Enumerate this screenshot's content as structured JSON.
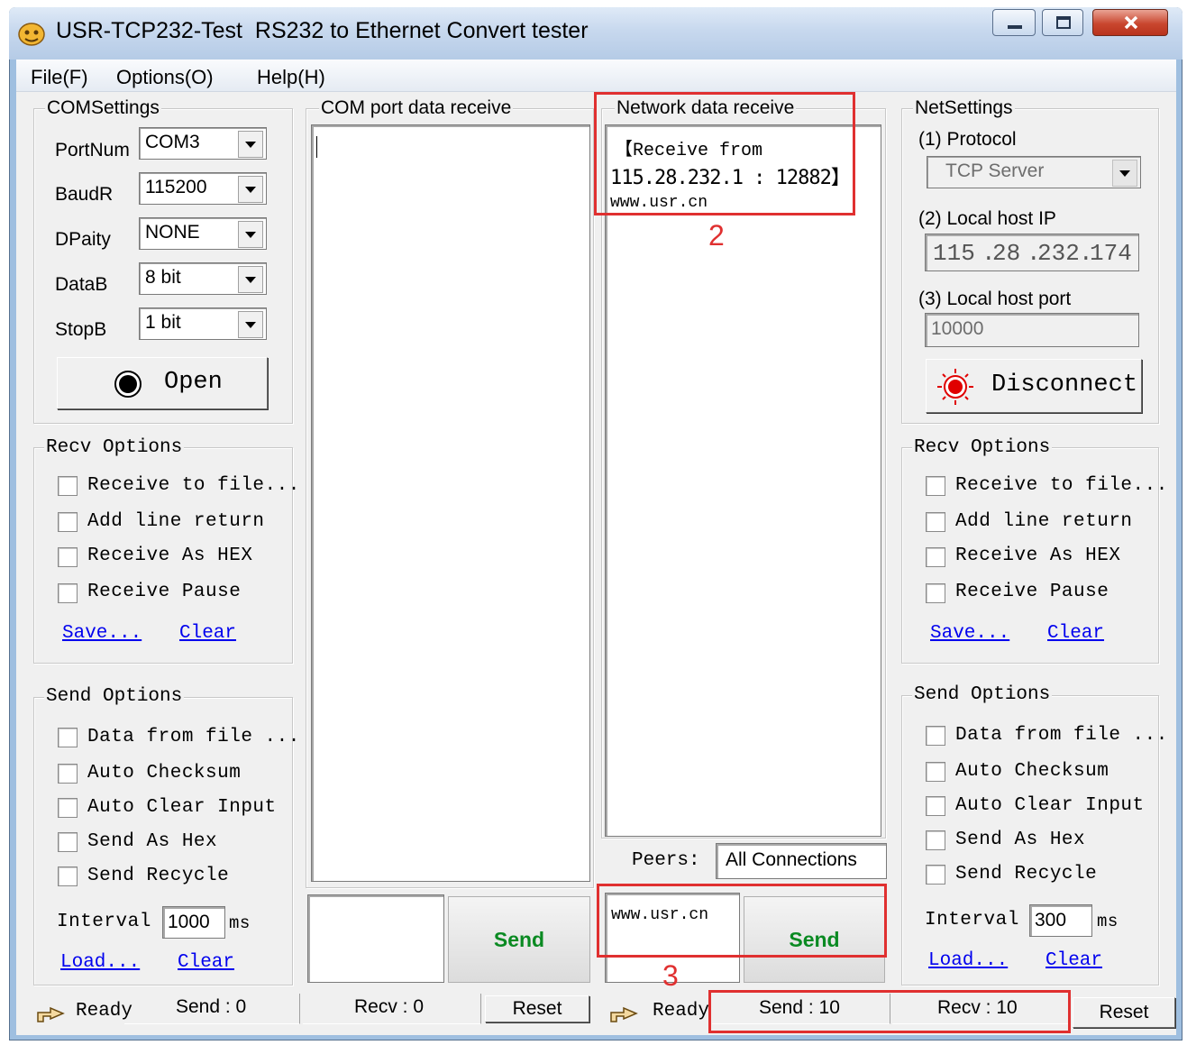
{
  "window": {
    "title": "USR-TCP232-Test  RS232 to Ethernet Convert tester"
  },
  "menu": [
    "File(F)",
    "Options(O)",
    "Help(H)"
  ],
  "com_settings": {
    "title": "COMSettings",
    "fields": [
      {
        "label": "PortNum",
        "value": "COM3"
      },
      {
        "label": "BaudR",
        "value": "115200"
      },
      {
        "label": "DPaity",
        "value": "NONE"
      },
      {
        "label": "DataB",
        "value": "8 bit"
      },
      {
        "label": "StopB",
        "value": "1 bit"
      }
    ],
    "open_button": "Open"
  },
  "com_receive": {
    "title": "COM port data receive"
  },
  "net_receive": {
    "title": "Network data receive",
    "lines": [
      "【Receive from",
      "115.28.232.1 : 12882】",
      "www.usr.cn"
    ]
  },
  "net_settings": {
    "title": "NetSettings",
    "protocol_label": "(1) Protocol",
    "protocol_value": "TCP Server",
    "ip_label": "(2) Local host IP",
    "ip_parts": [
      "115",
      "28",
      "232",
      "174"
    ],
    "port_label": "(3) Local host port",
    "port_value": "10000",
    "disconnect_button": "Disconnect"
  },
  "left_recv_options": {
    "title": "Recv Options",
    "items": [
      "Receive to file...",
      "Add line return",
      "Receive As HEX",
      "Receive Pause"
    ],
    "save_link": "Save...",
    "clear_link": "Clear"
  },
  "right_recv_options": {
    "title": "Recv Options",
    "items": [
      "Receive to file...",
      "Add line return",
      "Receive As HEX",
      "Receive Pause"
    ],
    "save_link": "Save...",
    "clear_link": "Clear"
  },
  "left_send_options": {
    "title": "Send Options",
    "items": [
      "Data from file ...",
      "Auto Checksum",
      "Auto Clear Input",
      "Send As Hex",
      "Send Recycle"
    ],
    "interval_label": "Interval",
    "interval_value": "1000",
    "interval_unit": "ms",
    "load_link": "Load...",
    "clear_link": "Clear"
  },
  "right_send_options": {
    "title": "Send Options",
    "items": [
      "Data from file ...",
      "Auto Checksum",
      "Auto Clear Input",
      "Send As Hex",
      "Send Recycle"
    ],
    "interval_label": "Interval",
    "interval_value": "300",
    "interval_unit": "ms",
    "load_link": "Load...",
    "clear_link": "Clear"
  },
  "com_send": {
    "input_value": "",
    "button": "Send"
  },
  "net_send": {
    "peers_label": "Peers:",
    "peers_value": "All Connections",
    "input_value": "www.usr.cn",
    "button": "Send"
  },
  "status_left": {
    "ready": "Ready",
    "send": "Send : 0",
    "recv": "Recv : 0",
    "reset": "Reset"
  },
  "status_right": {
    "ready": "Ready",
    "send": "Send : 10",
    "recv": "Recv : 10",
    "reset": "Reset"
  },
  "annotations": [
    "2",
    "3"
  ]
}
